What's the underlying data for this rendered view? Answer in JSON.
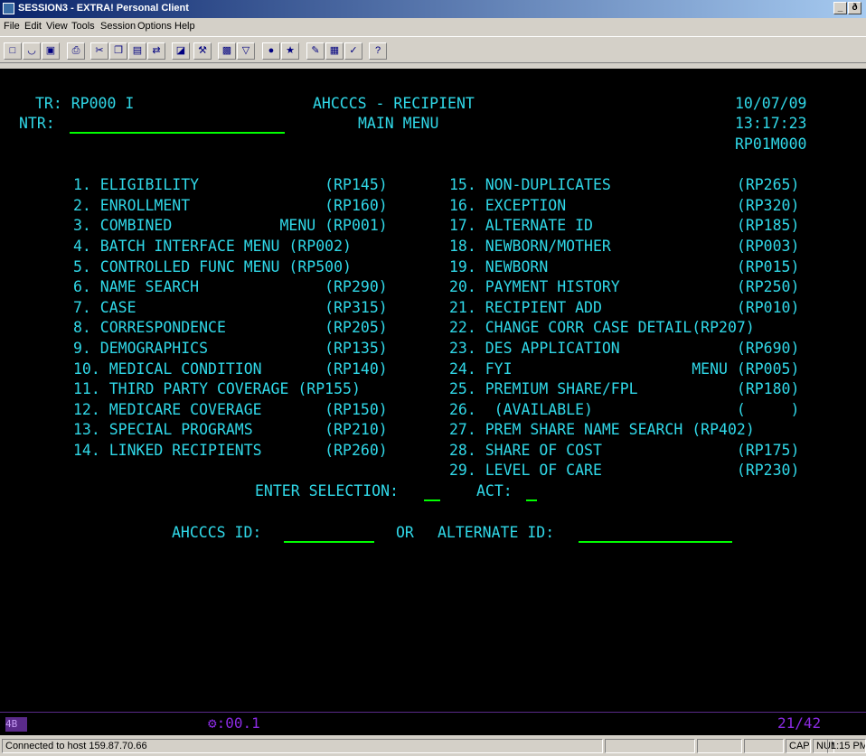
{
  "window": {
    "title": "SESSION3 - EXTRA! Personal Client",
    "minimize": "_",
    "restore": "ð"
  },
  "menu": [
    "File",
    "Edit",
    "View",
    "Tools",
    "Session",
    "Options",
    "Help"
  ],
  "toolbar_icons": [
    "new-document-icon",
    "open-folder-icon",
    "save-icon",
    "print-icon",
    "cut-icon",
    "copy-icon",
    "paste-icon",
    "send-icon",
    "folder-icon",
    "tools-icon",
    "printer-setup-icon",
    "filter-icon",
    "record-icon",
    "macro-icon",
    "edit-macro-icon",
    "grid-icon",
    "edit-icon",
    "help-icon"
  ],
  "screen": {
    "tr": "TR: RP000 I",
    "ntr": "NTR:",
    "system_title": "AHCCCS - RECIPIENT",
    "menu_title": "MAIN MENU",
    "date": "10/07/09",
    "time": "13:17:23",
    "screen_id": "RP01M000",
    "left_items": [
      "1. ELIGIBILITY              (RP145)",
      "2. ENROLLMENT               (RP160)",
      "3. COMBINED            MENU (RP001)",
      "4. BATCH INTERFACE MENU (RP002)",
      "5. CONTROLLED FUNC MENU (RP500)",
      "6. NAME SEARCH              (RP290)",
      "7. CASE                     (RP315)",
      "8. CORRESPONDENCE           (RP205)",
      "9. DEMOGRAPHICS             (RP135)",
      "10. MEDICAL CONDITION       (RP140)",
      "11. THIRD PARTY COVERAGE (RP155)",
      "12. MEDICARE COVERAGE       (RP150)",
      "13. SPECIAL PROGRAMS        (RP210)",
      "14. LINKED RECIPIENTS       (RP260)"
    ],
    "right_items": [
      "15. NON-DUPLICATES              (RP265)",
      "16. EXCEPTION                   (RP320)",
      "17. ALTERNATE ID                (RP185)",
      "18. NEWBORN/MOTHER              (RP003)",
      "19. NEWBORN                     (RP015)",
      "20. PAYMENT HISTORY             (RP250)",
      "21. RECIPIENT ADD               (RP010)",
      "22. CHANGE CORR CASE DETAIL(RP207)",
      "23. DES APPLICATION             (RP690)",
      "24. FYI                    MENU (RP005)",
      "25. PREMIUM SHARE/FPL           (RP180)",
      "26.  (AVAILABLE)                (     )",
      "27. PREM SHARE NAME SEARCH (RP402)",
      "28. SHARE OF COST               (RP175)",
      "29. LEVEL OF CARE               (RP230)"
    ],
    "enter_selection_label": "ENTER SELECTION:",
    "act_label": "ACT:",
    "ahcccs_id_label": "AHCCCS ID:",
    "or_label": "OR",
    "alternate_id_label": "ALTERNATE ID:"
  },
  "oia": {
    "indicator": "4B",
    "timer": "⚙:00.1",
    "cursor_pos": "21/42"
  },
  "status": {
    "connection": "Connected to host 159.87.70.66",
    "cap": "CAP",
    "num": "NUM",
    "clock": "1:15 PM"
  }
}
